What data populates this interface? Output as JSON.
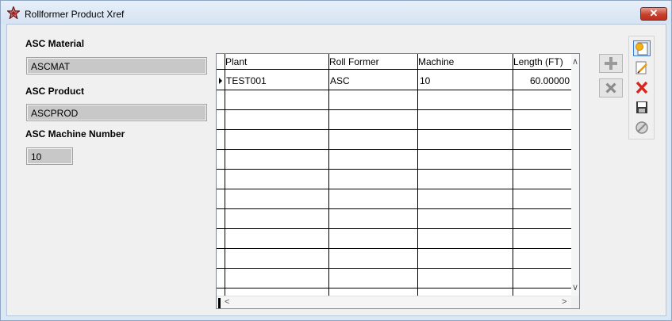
{
  "window": {
    "title": "Rollformer Product Xref",
    "close_label": "✕"
  },
  "form": {
    "material_label": "ASC Material",
    "material_value": "ASCMAT",
    "product_label": "ASC Product",
    "product_value": "ASCPROD",
    "machine_label": "ASC Machine Number",
    "machine_value": "10"
  },
  "grid": {
    "columns": [
      "Plant",
      "Roll Former",
      "Machine",
      "Length (FT)"
    ],
    "rows": [
      {
        "plant": "TEST001",
        "roll_former": "ASC",
        "machine": "10",
        "length": "60.00000"
      }
    ]
  },
  "icons": {
    "add": "plus-icon",
    "delete": "x-icon",
    "new": "new-record-icon",
    "edit": "edit-icon",
    "remove": "red-x-icon",
    "save": "save-disk-icon",
    "cancel": "cancel-circle-icon"
  },
  "scroll": {
    "up": "∧",
    "down": "∨",
    "left": "<",
    "right": ">"
  }
}
